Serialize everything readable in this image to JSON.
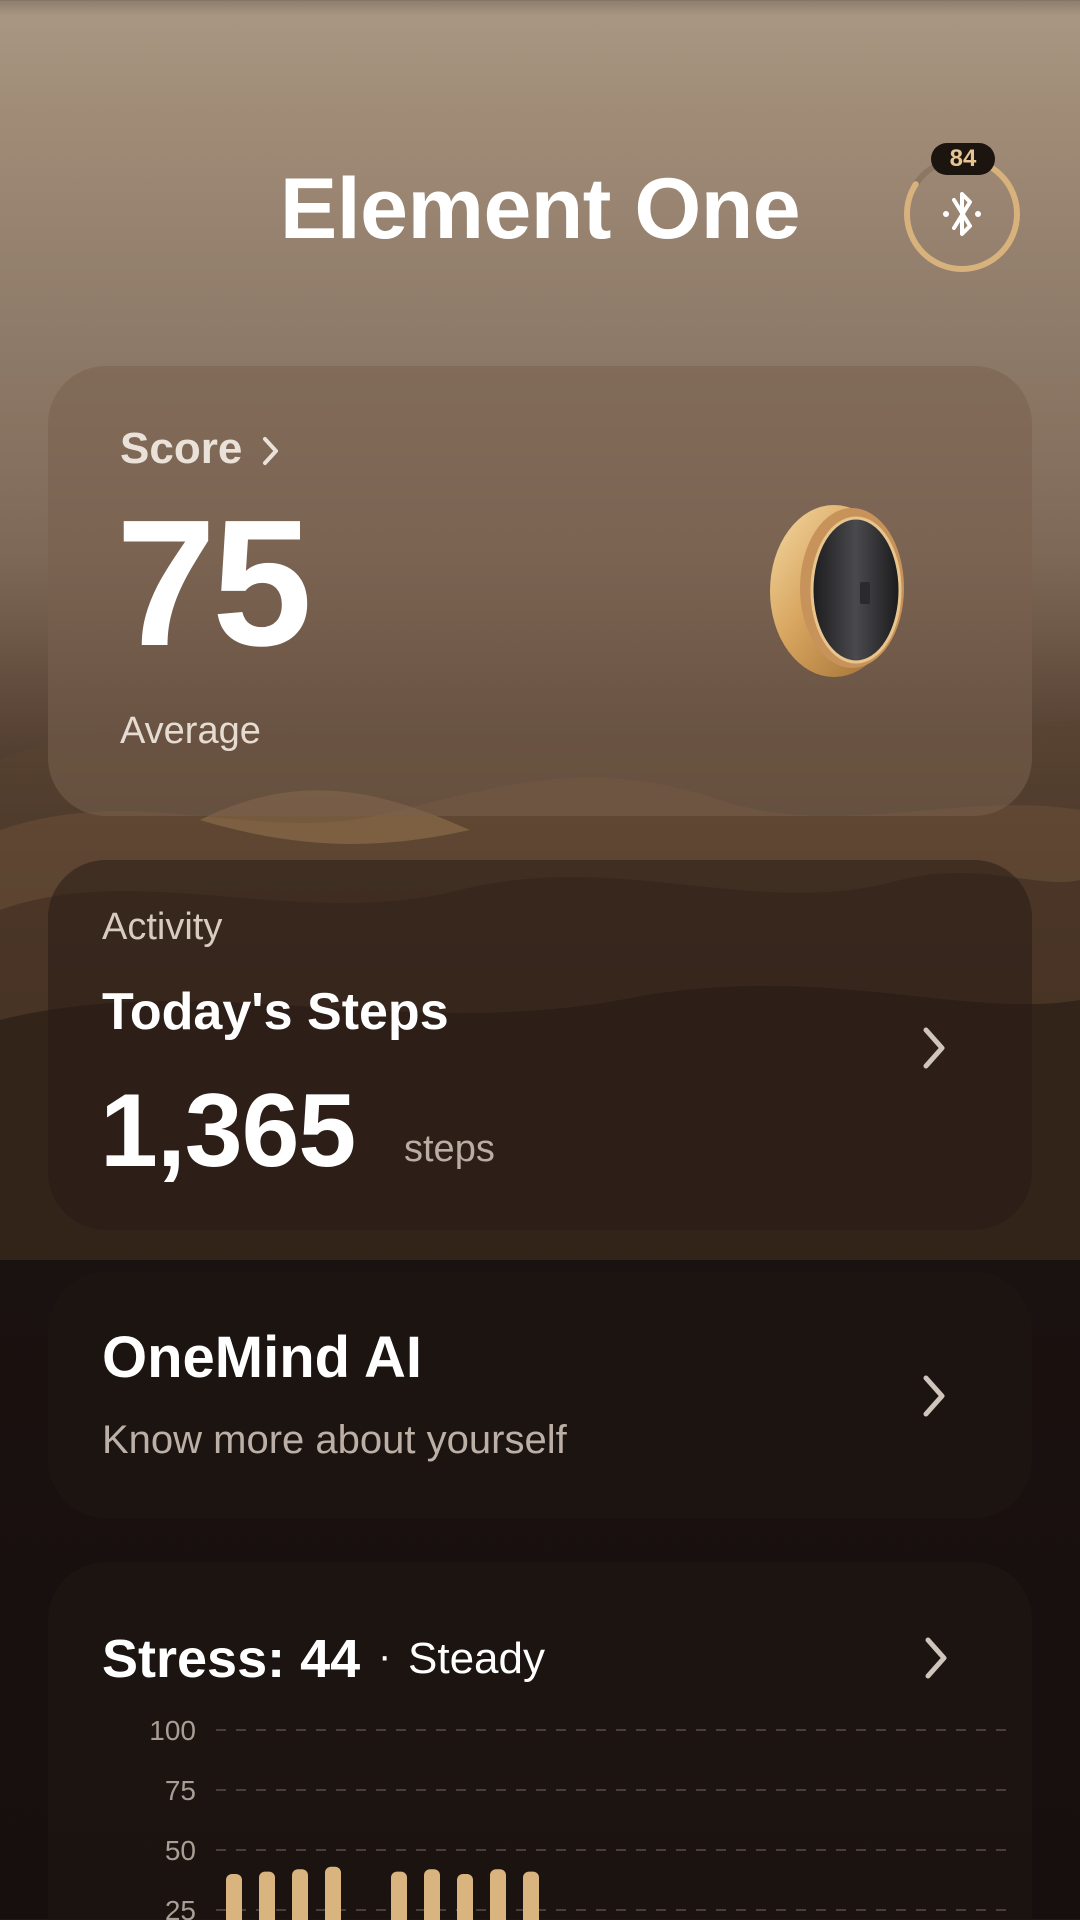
{
  "header": {
    "title": "Element One",
    "battery_level": "84",
    "battery_fraction": 0.84,
    "connection_icon": "bluetooth-icon"
  },
  "score": {
    "label": "Score",
    "value": "75",
    "sub_label": "Average"
  },
  "activity": {
    "category": "Activity",
    "title": "Today's Steps",
    "value": "1,365",
    "unit": "steps"
  },
  "onemind": {
    "title": "OneMind AI",
    "subtitle": "Know more about yourself"
  },
  "stress": {
    "title": "Stress: 44",
    "separator": "·",
    "state": "Steady",
    "chart_data": {
      "type": "bar",
      "ylim": [
        0,
        100
      ],
      "grid": true,
      "yticks": [
        "100",
        "75",
        "50",
        "25"
      ],
      "values": [
        40,
        41,
        42,
        43,
        0,
        41,
        42,
        40,
        42,
        41
      ]
    }
  },
  "colors": {
    "accent": "#d9b37a",
    "bar": "#d9b47e"
  }
}
